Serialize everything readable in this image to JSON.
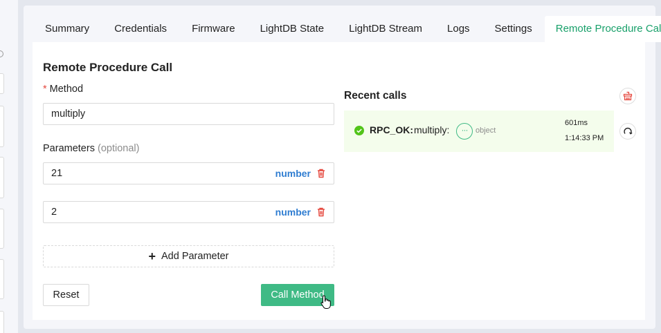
{
  "tabs": [
    {
      "label": "Summary"
    },
    {
      "label": "Credentials"
    },
    {
      "label": "Firmware"
    },
    {
      "label": "LightDB State"
    },
    {
      "label": "LightDB Stream"
    },
    {
      "label": "Logs"
    },
    {
      "label": "Settings"
    },
    {
      "label": "Remote Procedure Call",
      "active": true
    }
  ],
  "form": {
    "title": "Remote Procedure Call",
    "method_required_mark": "*",
    "method_label": "Method",
    "method_value": "multiply",
    "params_label": "Parameters",
    "params_optional": "(optional)",
    "params": [
      {
        "value": "21",
        "type": "number"
      },
      {
        "value": "2",
        "type": "number"
      }
    ],
    "add_param_label": "Add Parameter",
    "reset_label": "Reset",
    "call_label": "Call Method"
  },
  "recent": {
    "title": "Recent calls",
    "calls": [
      {
        "status": "RPC_OK:",
        "method": "multiply:",
        "result_type": "object",
        "duration": "601ms",
        "time": "1:14:33 PM"
      }
    ]
  },
  "colors": {
    "accent": "#3fba85",
    "active_tab": "#18a06a",
    "type_label": "#2f7dd1",
    "danger": "#e5483e",
    "call_row_bg": "#f4fdec"
  },
  "icons": [
    "trash-icon",
    "plus-icon",
    "check-circle-icon",
    "ellipsis-icon",
    "clear-history-icon",
    "refresh-icon",
    "hand-cursor-icon"
  ]
}
